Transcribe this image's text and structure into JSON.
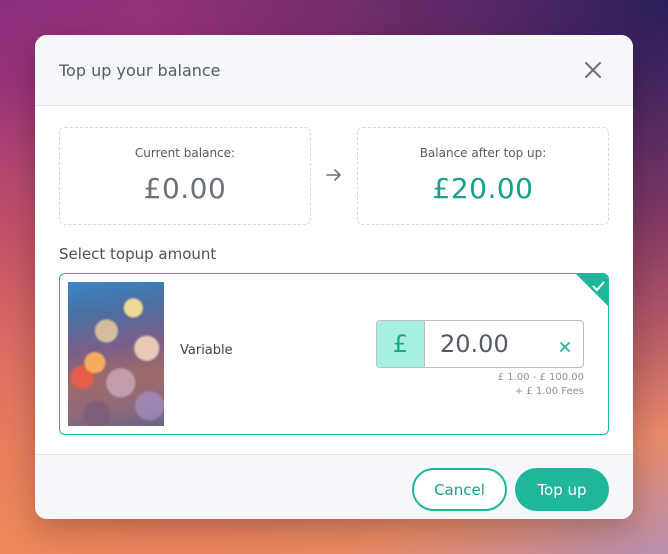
{
  "modal": {
    "title": "Top up your balance",
    "close_icon": "close-icon"
  },
  "balance": {
    "current_label": "Current balance:",
    "current_amount": "£0.00",
    "after_label": "Balance after top up:",
    "after_amount": "£20.00",
    "arrow_icon": "arrow-right-icon"
  },
  "topup": {
    "section_label": "Select topup amount",
    "option_label": "Variable",
    "selected": true,
    "currency_symbol": "£",
    "amount_value": "20.00",
    "range_text": "£ 1.00 - £ 100.00",
    "fee_text": "+ £ 1.00 Fees",
    "clear_icon": "clear-icon",
    "check_icon": "checkmark-icon"
  },
  "footer": {
    "cancel_label": "Cancel",
    "topup_label": "Top up"
  },
  "colors": {
    "accent": "#1fb69c",
    "accent_text": "#16a08a",
    "prefix_bg": "#a7f0df"
  }
}
